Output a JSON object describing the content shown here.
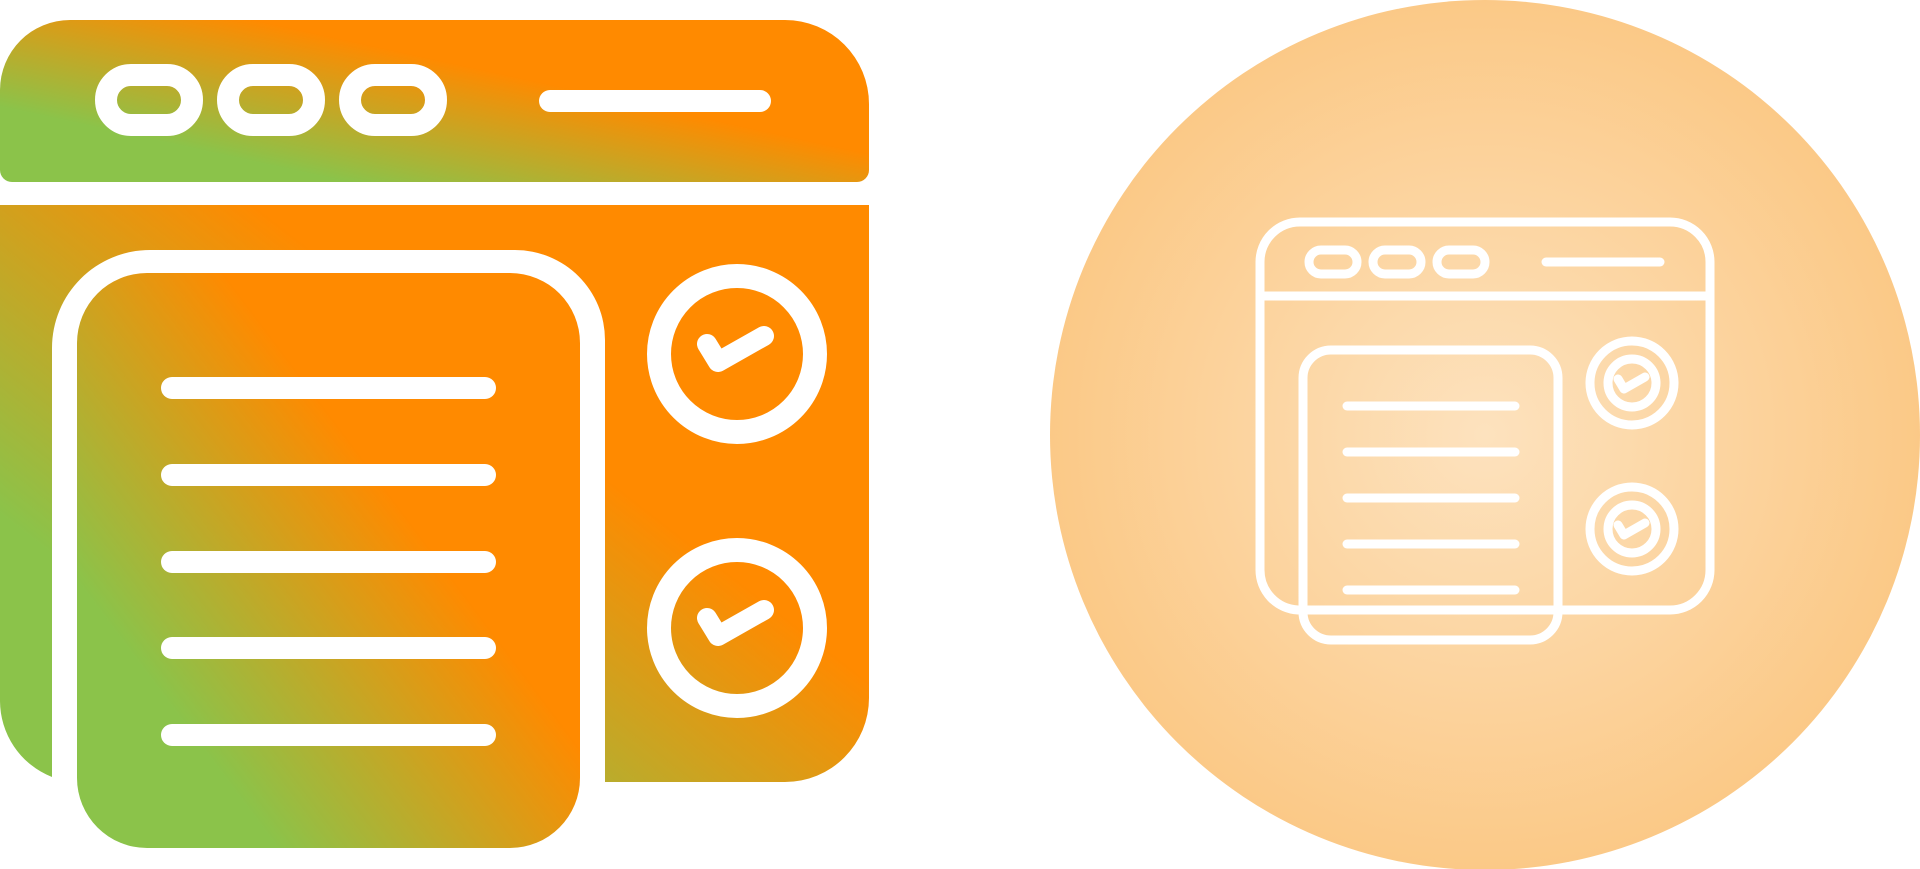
{
  "icons": [
    {
      "name": "checklist-document-browser",
      "style": "glyph",
      "gradient": {
        "from": "#8bc34a",
        "to": "#ff8a00"
      },
      "check_items": 2,
      "text_lines": 5,
      "window_controls": 3
    },
    {
      "name": "checklist-document-browser",
      "style": "line",
      "background_circle": {
        "center": "#fde2be",
        "edge": "#fbc987"
      },
      "stroke_color": "#ffffff",
      "check_items": 2,
      "text_lines": 5,
      "window_controls": 3
    }
  ]
}
